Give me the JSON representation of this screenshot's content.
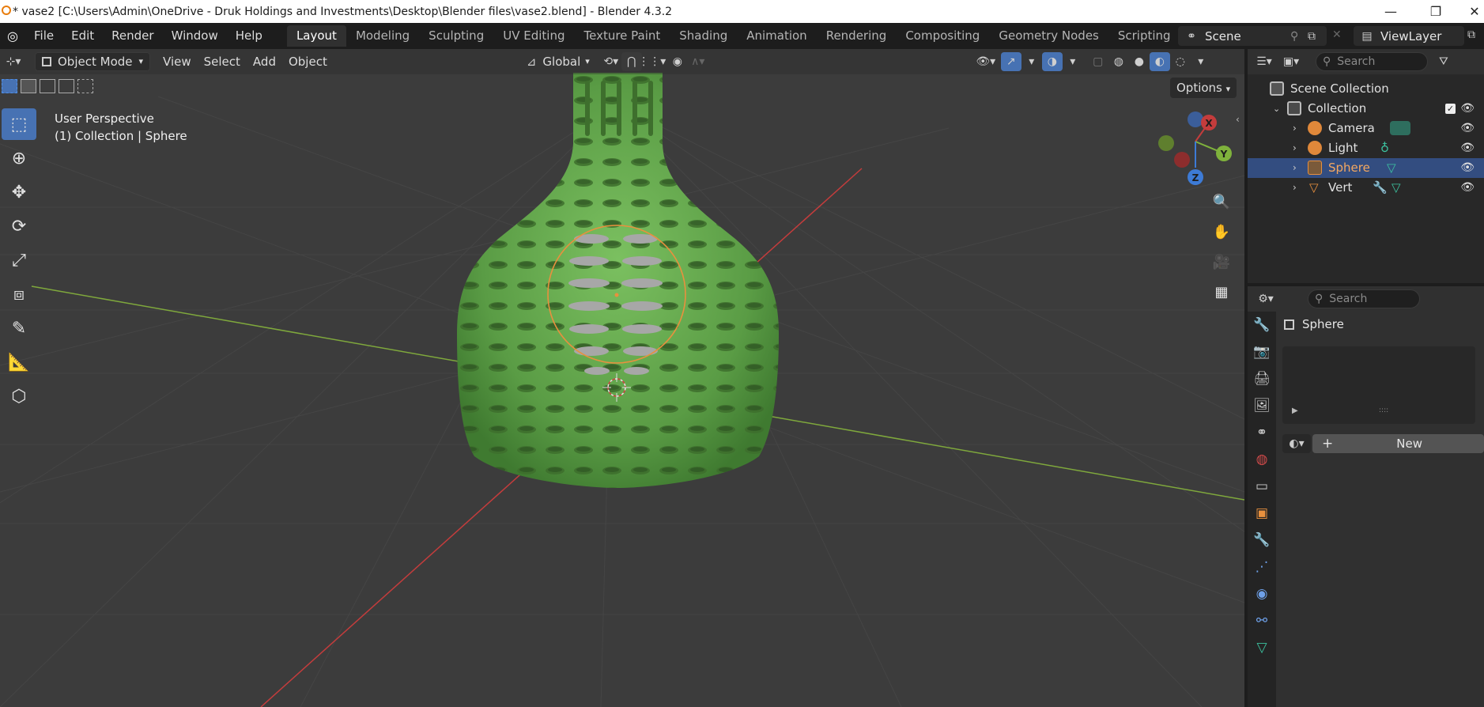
{
  "window": {
    "title": "* vase2 [C:\\Users\\Admin\\OneDrive - Druk Holdings and Investments\\Desktop\\Blender files\\vase2.blend] - Blender 4.3.2",
    "minimize": "—",
    "maximize": "❐",
    "close": "✕"
  },
  "menu": {
    "file": "File",
    "edit": "Edit",
    "render": "Render",
    "window": "Window",
    "help": "Help"
  },
  "workspaces": [
    "Layout",
    "Modeling",
    "Sculpting",
    "UV Editing",
    "Texture Paint",
    "Shading",
    "Animation",
    "Rendering",
    "Compositing",
    "Geometry Nodes",
    "Scripting"
  ],
  "workspace_add": "+",
  "scene": {
    "name": "Scene",
    "view_layer": "ViewLayer"
  },
  "viewport": {
    "mode": "Object Mode",
    "menus": [
      "View",
      "Select",
      "Add",
      "Object"
    ],
    "transform_orientation": "Global",
    "options_label": "Options",
    "info_line1": "User Perspective",
    "info_line2": "(1) Collection | Sphere",
    "gizmo_axes": [
      "X",
      "Y",
      "Z"
    ]
  },
  "outliner": {
    "search_placeholder": "Search",
    "root": "Scene Collection",
    "collection": "Collection",
    "items": [
      {
        "label": "Camera",
        "selected": false
      },
      {
        "label": "Light",
        "selected": false
      },
      {
        "label": "Sphere",
        "selected": true
      },
      {
        "label": "Vert",
        "selected": false
      }
    ]
  },
  "properties": {
    "search_placeholder": "Search",
    "object_name": "Sphere",
    "new_button": "New",
    "add_symbol": "+",
    "panel_grip": "::::"
  },
  "colors": {
    "accent_blue": "#4772b3",
    "selection_row": "#334d80",
    "object_orange": "#e8903e",
    "mesh_green": "#5ea84a",
    "axis_x": "#c43c3c",
    "axis_y": "#7fb23c"
  }
}
